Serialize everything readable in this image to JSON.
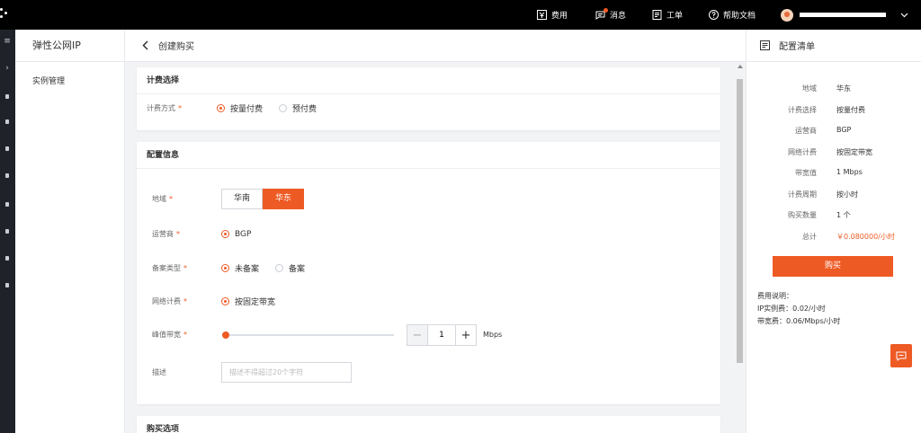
{
  "topbar": {
    "items": [
      {
        "icon": "fee-icon",
        "label": "费用"
      },
      {
        "icon": "message-icon",
        "label": "消息"
      },
      {
        "icon": "ticket-icon",
        "label": "工单"
      },
      {
        "icon": "help-icon",
        "label": "帮助文档"
      }
    ]
  },
  "product": {
    "title": "弹性公网IP",
    "nav": [
      "实例管理"
    ]
  },
  "page": {
    "title": "创建购买"
  },
  "billing": {
    "heading": "计费选择",
    "method_label": "计费方式",
    "options": [
      "按量付费",
      "预付费"
    ],
    "selected": "按量付费"
  },
  "config": {
    "heading": "配置信息",
    "region_label": "地域",
    "regions": [
      "华南",
      "华东"
    ],
    "region_selected": "华东",
    "isp_label": "运营商",
    "isp_option": "BGP",
    "filing_label": "备案类型",
    "filing_options": [
      "未备案",
      "备案"
    ],
    "filing_selected": "未备案",
    "network_label": "网络计费",
    "network_option": "按固定带宽",
    "bandwidth_label": "峰值带宽",
    "bandwidth_value": "1",
    "bandwidth_level": 0,
    "bandwidth_unit": "Mbps",
    "desc_label": "描述",
    "desc_placeholder": "描述不得超过20个字符"
  },
  "purchase": {
    "heading": "购买选项"
  },
  "summary": {
    "title": "配置清单",
    "rows": [
      {
        "k": "地域",
        "v": "华东"
      },
      {
        "k": "计费选择",
        "v": "按量付费"
      },
      {
        "k": "运营商",
        "v": "BGP"
      },
      {
        "k": "网络计费",
        "v": "按固定带宽"
      },
      {
        "k": "带宽值",
        "v": "1 Mbps"
      },
      {
        "k": "计费周期",
        "v": "按小时"
      },
      {
        "k": "购买数量",
        "v": "1 个"
      },
      {
        "k": "总计",
        "v": "￥0.080000/小时"
      }
    ],
    "buy_label": "购买",
    "fee_title": "费用说明：",
    "fee_lines": [
      "IP实例费：0.02/小时",
      "带宽费：0.06/Mbps/小时"
    ]
  },
  "colors": {
    "accent": "#ee5a24",
    "topbar": "#000000",
    "rail": "#1f2329"
  }
}
